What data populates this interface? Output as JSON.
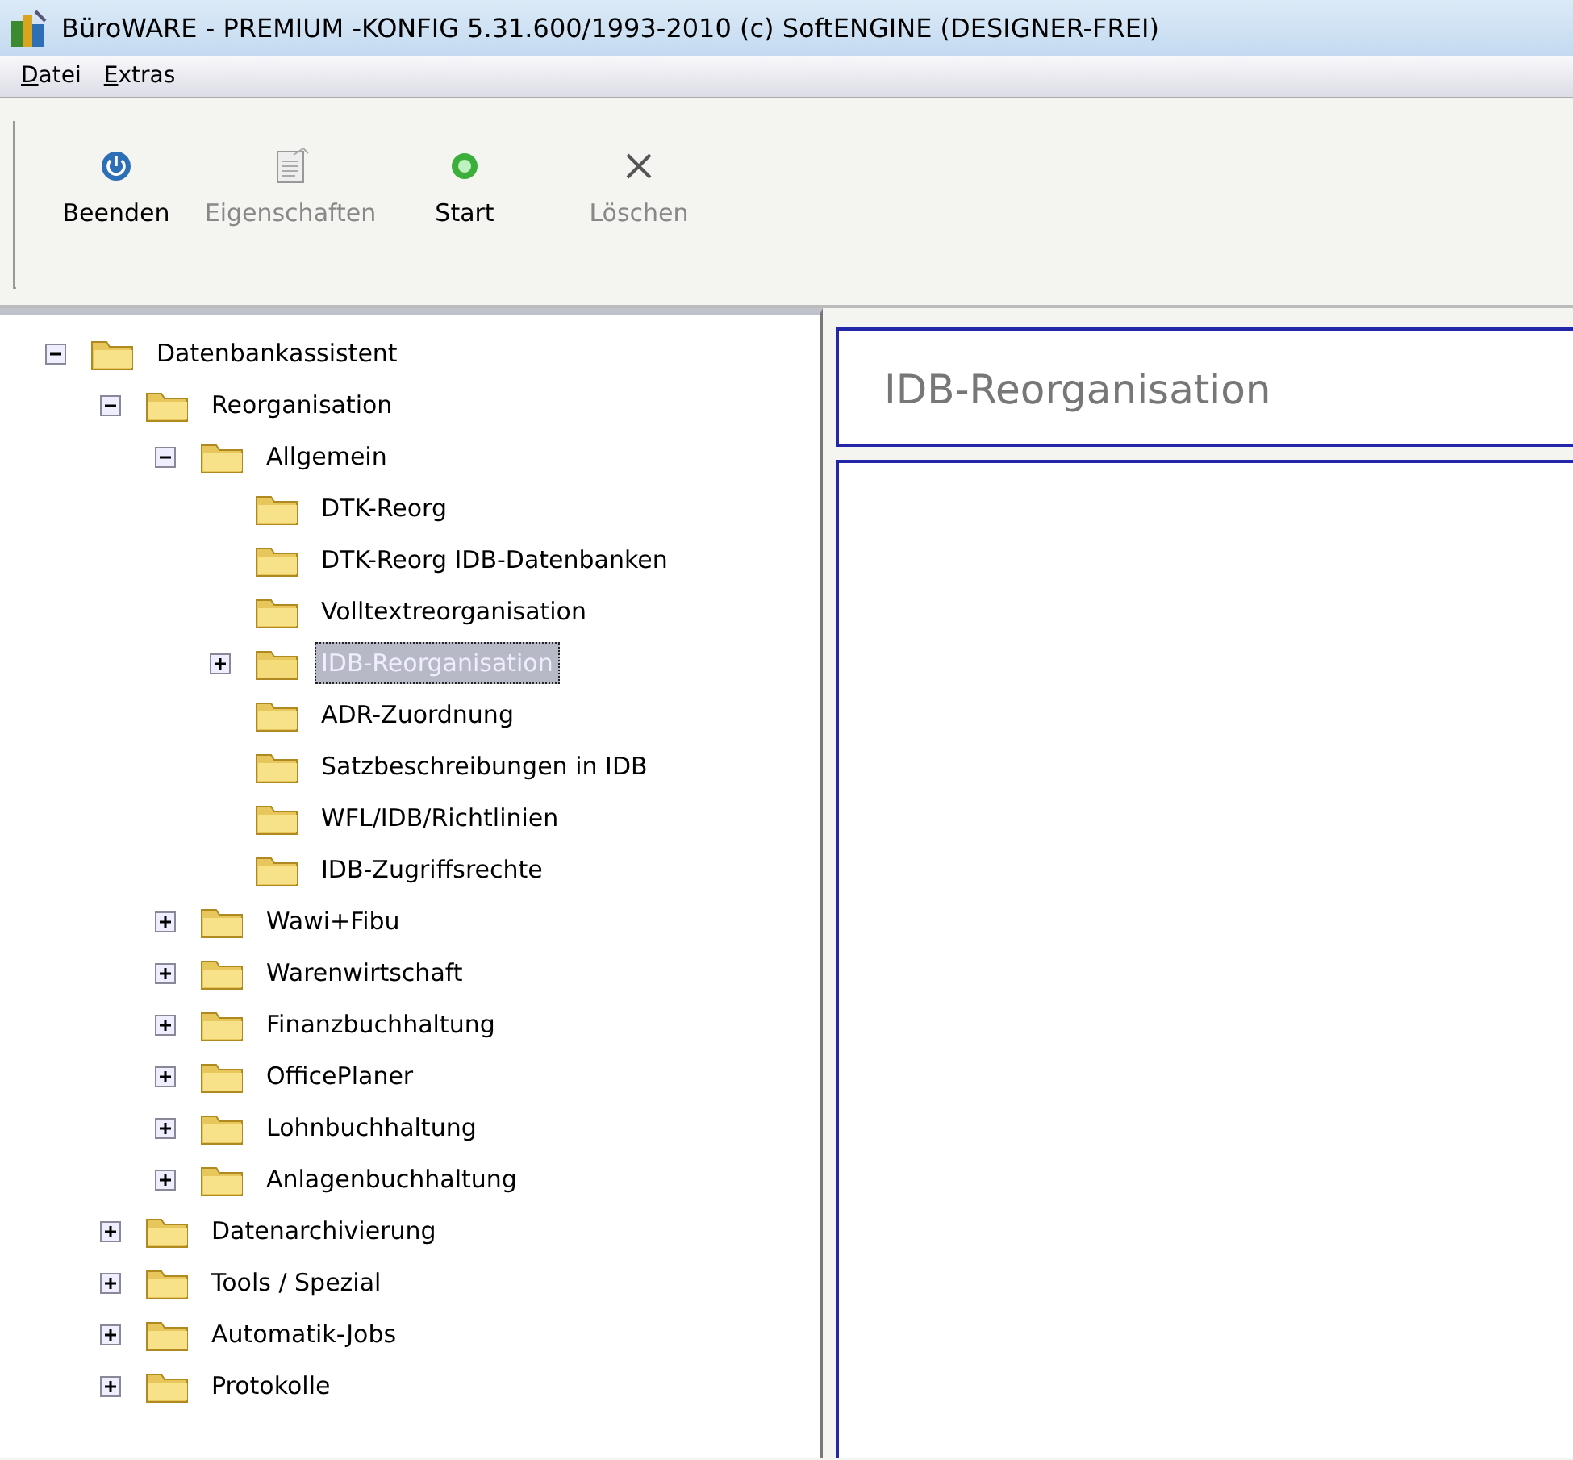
{
  "window": {
    "title": "BüroWARE - PREMIUM -KONFIG 5.31.600/1993-2010 (c) SoftENGINE (DESIGNER-FREI)"
  },
  "menu": [
    "Datei",
    "Extras"
  ],
  "toolbar": [
    {
      "kind": "power",
      "label": "Beenden",
      "disabled": false
    },
    {
      "kind": "properties",
      "label": "Eigenschaften",
      "disabled": true
    },
    {
      "kind": "start",
      "label": "Start",
      "disabled": false
    },
    {
      "kind": "delete",
      "label": "Löschen",
      "disabled": true
    }
  ],
  "tree": [
    {
      "label": "Datenbankassistent",
      "expanded": true,
      "selected": false,
      "children": [
        {
          "label": "Reorganisation",
          "expanded": true,
          "selected": false,
          "children": [
            {
              "label": "Allgemein",
              "expanded": true,
              "selected": false,
              "children": [
                {
                  "label": "DTK-Reorg",
                  "selected": false
                },
                {
                  "label": "DTK-Reorg IDB-Datenbanken",
                  "selected": false
                },
                {
                  "label": "Volltextreorganisation",
                  "selected": false
                },
                {
                  "label": "IDB-Reorganisation",
                  "expanded": false,
                  "selected": true
                },
                {
                  "label": "ADR-Zuordnung",
                  "selected": false
                },
                {
                  "label": "Satzbeschreibungen in IDB",
                  "selected": false
                },
                {
                  "label": "WFL/IDB/Richtlinien",
                  "selected": false
                },
                {
                  "label": "IDB-Zugriffsrechte",
                  "selected": false
                }
              ]
            },
            {
              "label": "Wawi+Fibu",
              "expanded": false,
              "selected": false
            },
            {
              "label": "Warenwirtschaft",
              "expanded": false,
              "selected": false
            },
            {
              "label": "Finanzbuchhaltung",
              "expanded": false,
              "selected": false
            },
            {
              "label": "OfficePlaner",
              "expanded": false,
              "selected": false
            },
            {
              "label": "Lohnbuchhaltung",
              "expanded": false,
              "selected": false
            },
            {
              "label": "Anlagenbuchhaltung",
              "expanded": false,
              "selected": false
            }
          ]
        },
        {
          "label": "Datenarchivierung",
          "expanded": false,
          "selected": false
        },
        {
          "label": "Tools / Spezial",
          "expanded": false,
          "selected": false
        },
        {
          "label": "Automatik-Jobs",
          "expanded": false,
          "selected": false
        },
        {
          "label": "Protokolle",
          "expanded": false,
          "selected": false
        }
      ]
    }
  ],
  "detail": {
    "title": "IDB-Reorganisation"
  }
}
